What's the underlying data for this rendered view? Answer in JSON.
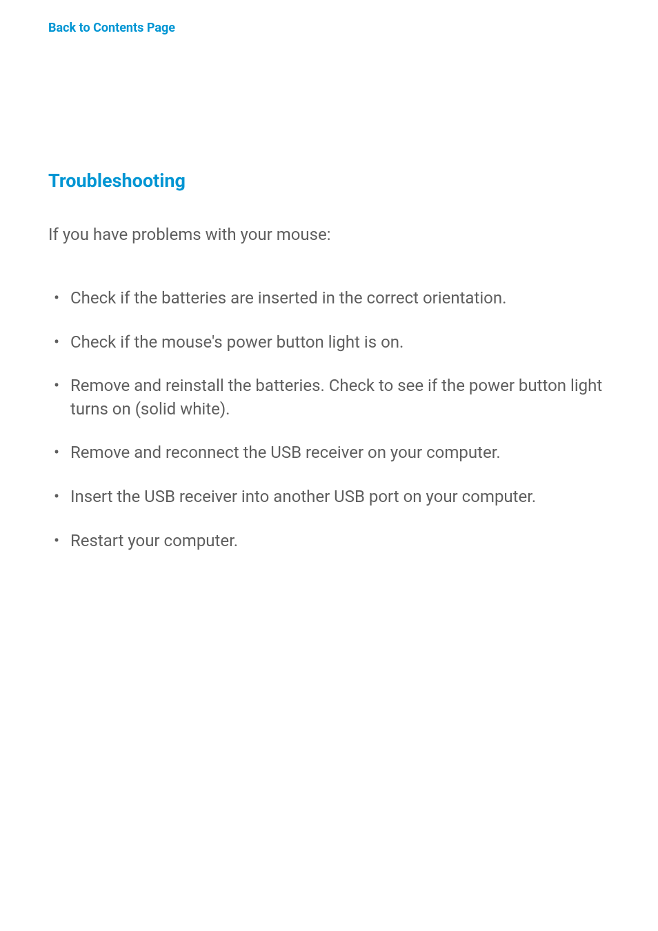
{
  "nav": {
    "back_link": "Back to Contents Page"
  },
  "heading": "Troubleshooting",
  "intro": "If you have problems with your mouse:",
  "items": [
    "Check if the batteries are inserted in the correct orientation.",
    "Check if the mouse's power button light is on.",
    "Remove and reinstall the batteries. Check to see if the power button light turns on (solid white).",
    "Remove and reconnect the USB receiver on your computer.",
    "Insert the USB receiver into another USB port on your computer.",
    "Restart your computer."
  ]
}
